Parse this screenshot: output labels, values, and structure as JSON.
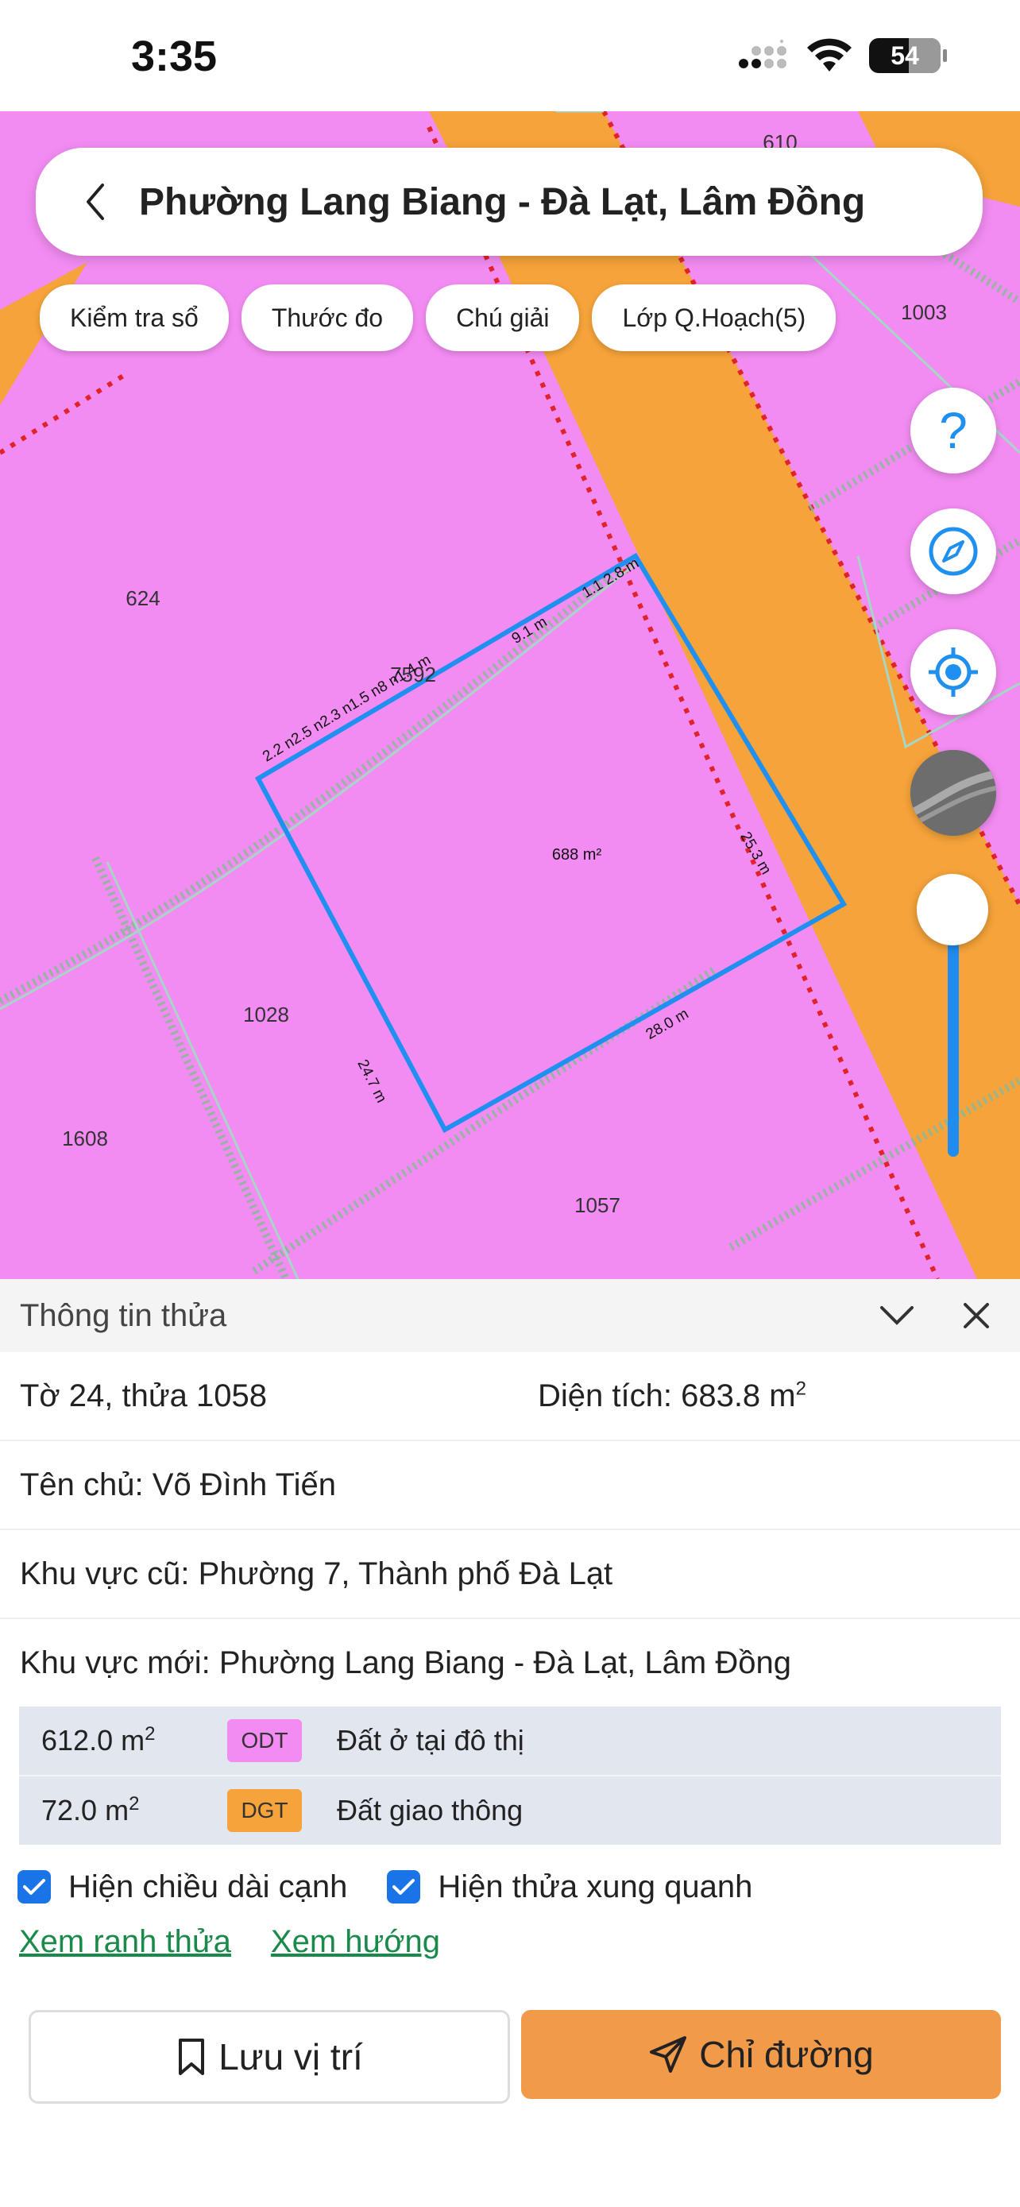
{
  "status_bar": {
    "time": "3:35",
    "battery": "54"
  },
  "search": {
    "title": "Phường Lang Biang - Đà Lạt, Lâm Đồng"
  },
  "chips": [
    "Kiểm tra sổ",
    "Thước đo",
    "Chú giải",
    "Lớp Q.Hoạch(5)"
  ],
  "map": {
    "parcel_labels": [
      "610",
      "1003",
      "624",
      "7592",
      "1028",
      "1608",
      "1057"
    ],
    "area_label": "688 m²",
    "edge_labels": [
      "9.1 m",
      "1.1 2.8 m",
      "2.2 n2.5 n2.3 n1.5 n8 n1.4 m",
      "25.3 m",
      "24.7 m",
      "28.0 m"
    ],
    "colors": {
      "residential": "#f28cf2",
      "road": "#f5a33a",
      "boundary": "#1f8ff0"
    }
  },
  "map_controls": {
    "help_symbol": "?"
  },
  "panel": {
    "title": "Thông tin thửa",
    "sheet_parcel": "Tờ 24, thửa 1058",
    "area_label": "Diện tích: 683.8 m",
    "area_sup": "2",
    "owner": "Tên chủ: Võ Đình Tiến",
    "old_area": "Khu vực cũ: Phường 7, Thành phố Đà Lạt",
    "new_area": "Khu vực mới: Phường Lang Biang - Đà Lạt, Lâm Đồng",
    "land_uses": [
      {
        "area": "612.0 m",
        "sup": "2",
        "code": "ODT",
        "name": "Đất ở tại đô thị",
        "color": "#f28cf2"
      },
      {
        "area": "72.0 m",
        "sup": "2",
        "code": "DGT",
        "name": "Đất giao thông",
        "color": "#f5a33a"
      }
    ],
    "check_edge_length": "Hiện chiều dài cạnh",
    "check_surrounding": "Hiện thửa xung quanh",
    "link_boundary": "Xem ranh thửa",
    "link_direction": "Xem hướng",
    "save_button": "Lưu vị trí",
    "route_button": "Chỉ đường"
  }
}
